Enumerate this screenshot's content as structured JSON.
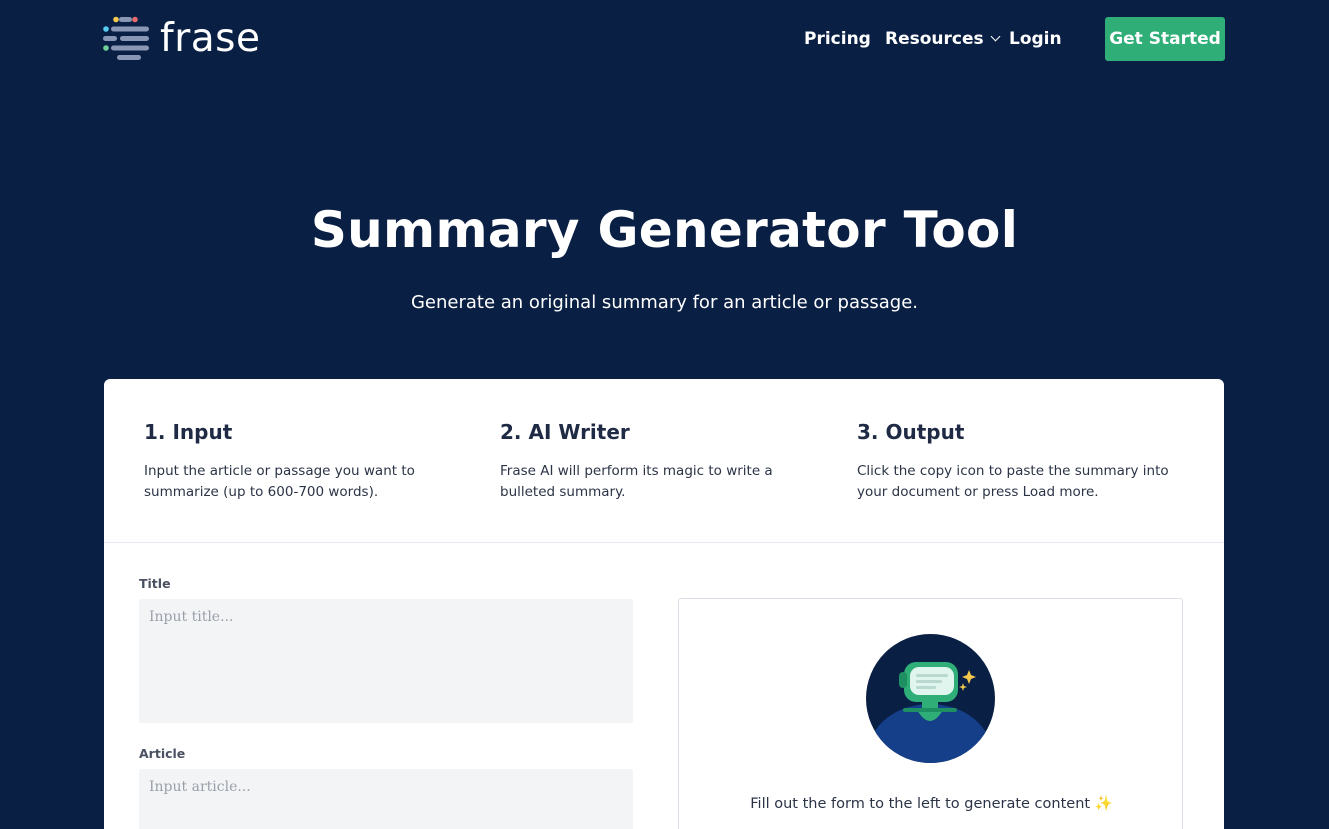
{
  "header": {
    "logo_text": "frase",
    "nav": {
      "pricing": "Pricing",
      "resources": "Resources",
      "login": "Login"
    },
    "cta_label": "Get Started"
  },
  "hero": {
    "title": "Summary Generator Tool",
    "subtitle": "Generate an original summary for an article or passage."
  },
  "steps": [
    {
      "title": "1. Input",
      "description": "Input the article or passage you want to summarize (up to 600-700 words)."
    },
    {
      "title": "2. AI Writer",
      "description": "Frase AI will perform its magic to write a bulleted summary."
    },
    {
      "title": "3. Output",
      "description": "Click the copy icon to paste the summary into your document or press Load more."
    }
  ],
  "form": {
    "title_label": "Title",
    "title_placeholder": "Input title...",
    "article_label": "Article",
    "article_placeholder": "Input article..."
  },
  "output": {
    "message": "Fill out the form to the left to generate content ✨"
  },
  "colors": {
    "background": "#0a1f44",
    "cta": "#2fae78",
    "robot": "#2fae78"
  }
}
